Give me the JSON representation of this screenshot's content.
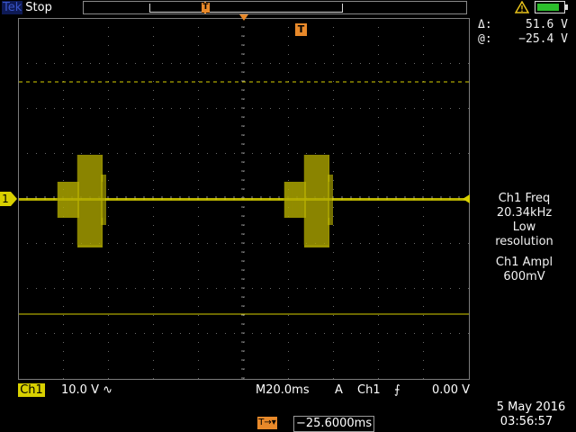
{
  "header": {
    "brand": "Tek",
    "acq_state": "Stop"
  },
  "cursor_readout": {
    "delta_label": "Δ:",
    "delta_value": "51.6 V",
    "at_label": "@:",
    "at_value": "−25.4 V"
  },
  "measurements": {
    "freq_title": "Ch1 Freq",
    "freq_value": "20.34kHz",
    "freq_note_1": "Low",
    "freq_note_2": "resolution",
    "ampl_title": "Ch1 Ampl",
    "ampl_value": "600mV"
  },
  "channel": {
    "badge": "Ch1",
    "marker": "1",
    "scale": "10.0 V",
    "coupling_symbol": "∿",
    "color": "#d8d000"
  },
  "timebase": {
    "label": "M",
    "value": "20.0ms"
  },
  "trigger": {
    "mode": "A",
    "source": "Ch1",
    "slope_symbol": "⨍",
    "level": "0.00 V",
    "marker": "T",
    "position_icon": "T→▾",
    "position": "−25.6000ms",
    "color": "#e8892a"
  },
  "datetime": {
    "date": "5 May 2016",
    "time": "03:56:57"
  },
  "battery": {
    "level": 0.85,
    "color": "#2cbf2c"
  },
  "icons": {
    "warning": "warning-icon",
    "battery": "battery-icon"
  }
}
